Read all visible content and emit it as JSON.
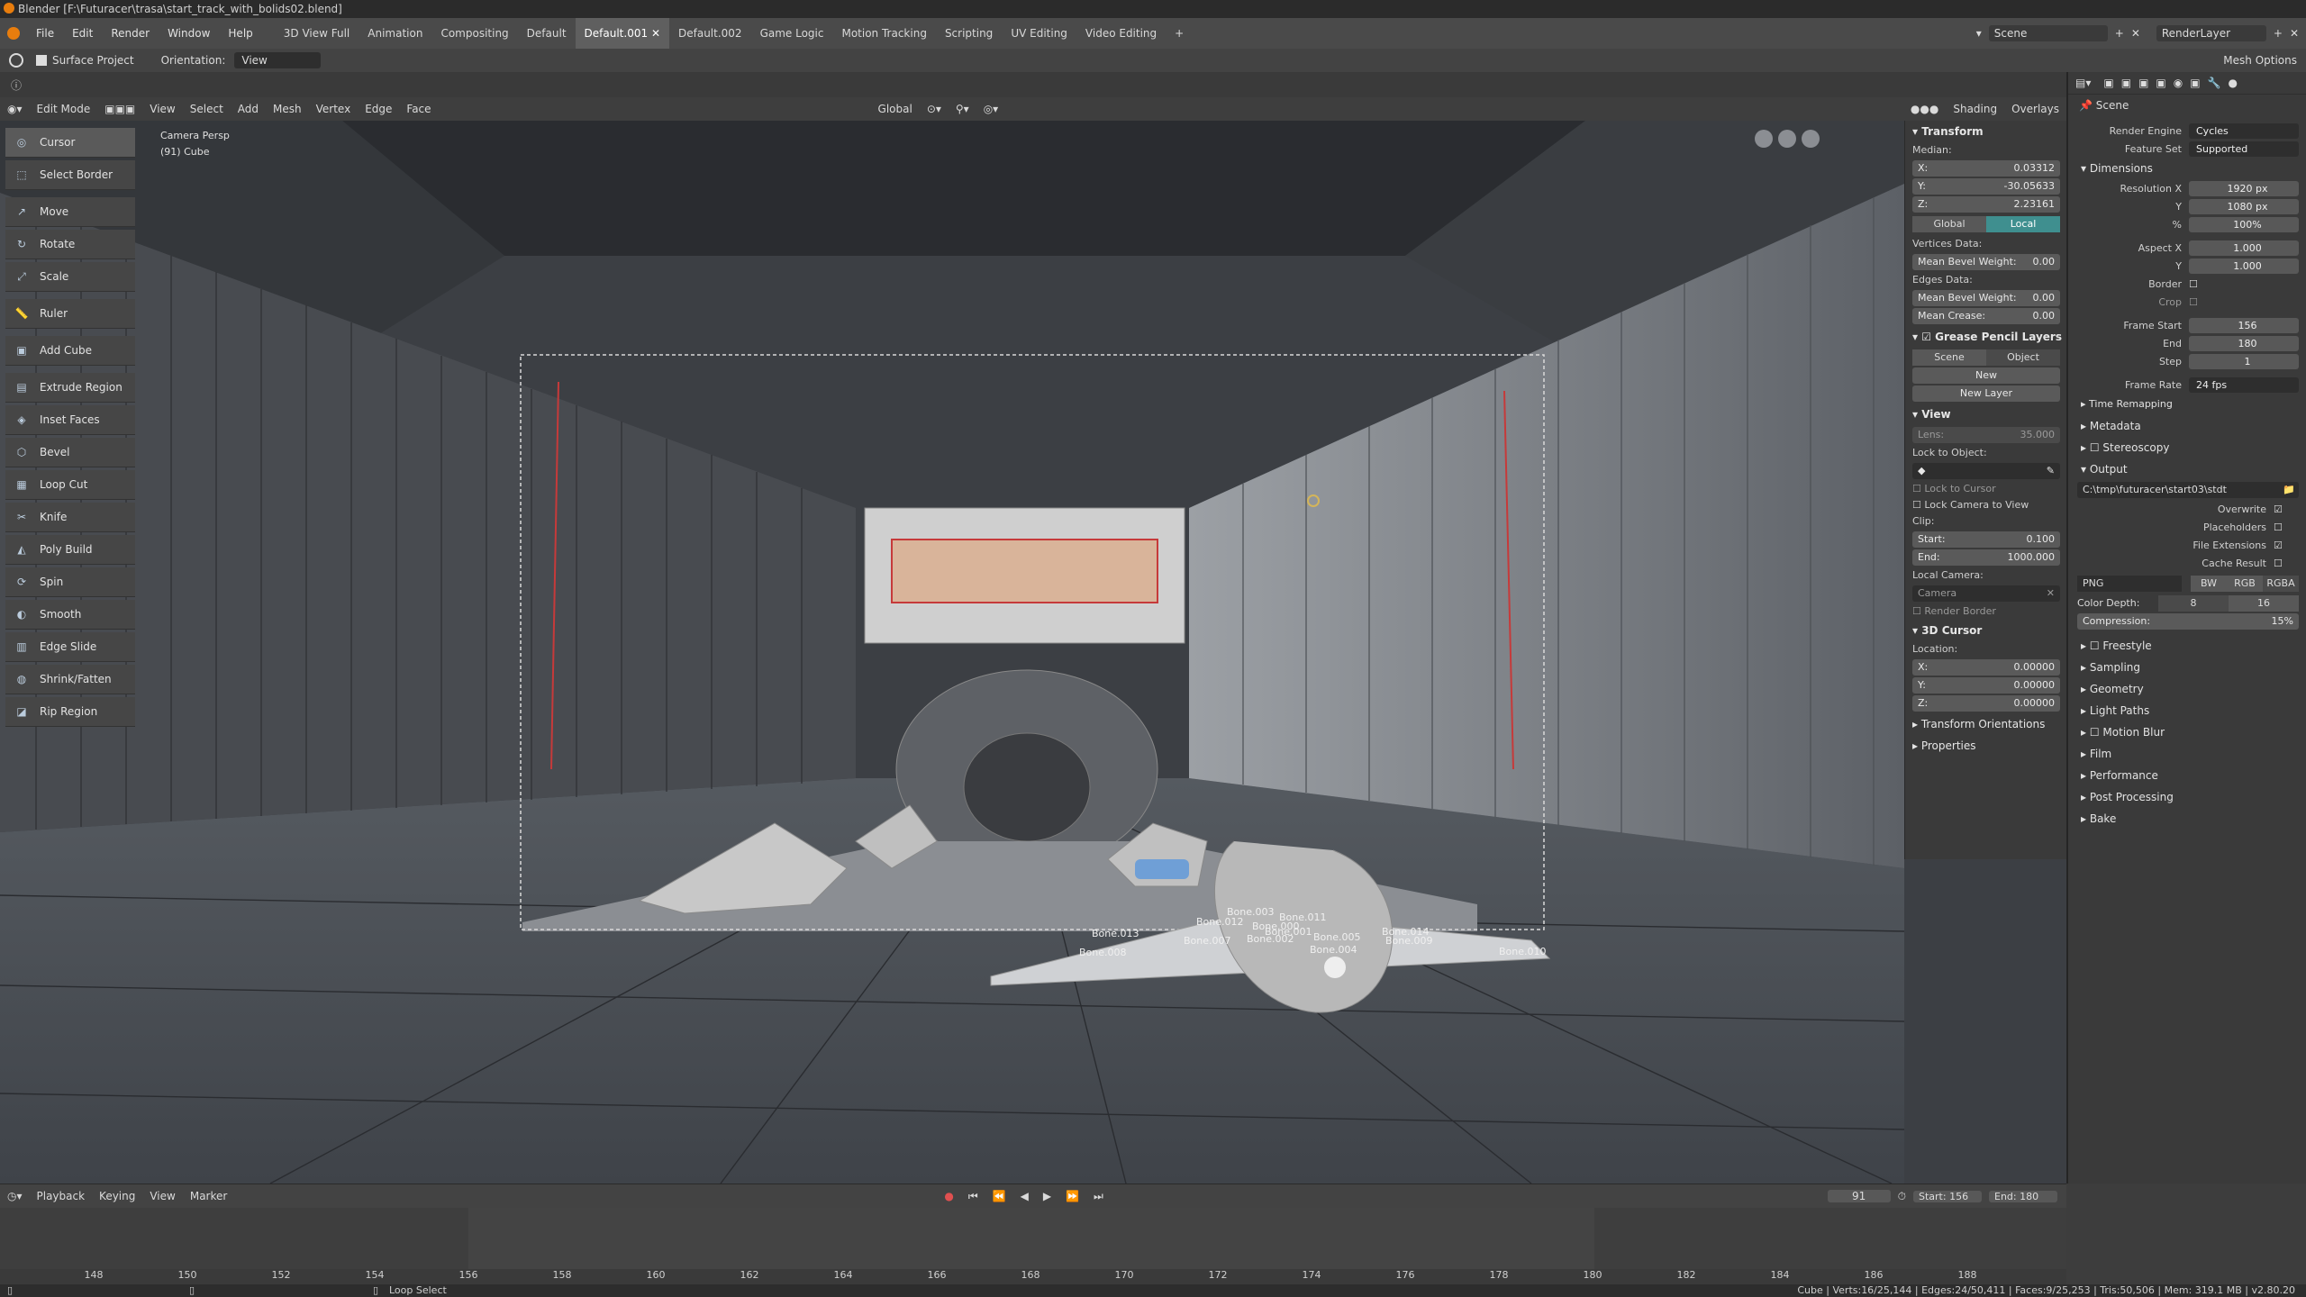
{
  "window_title": "Blender [F:\\Futuracer\\trasa\\start_track_with_bolids02.blend]",
  "menus": [
    "File",
    "Edit",
    "Render",
    "Window",
    "Help"
  ],
  "workspaces": [
    "3D View Full",
    "Animation",
    "Compositing",
    "Default",
    "Default.001",
    "Default.002",
    "Game Logic",
    "Motion Tracking",
    "Scripting",
    "UV Editing",
    "Video Editing"
  ],
  "active_workspace": "Default.001",
  "scene_name": "Scene",
  "render_layer": "RenderLayer",
  "tool_options": {
    "surface_project": "Surface Project",
    "orientation_label": "Orientation:",
    "orientation_value": "View",
    "mesh_options": "Mesh Options"
  },
  "viewport_header": {
    "mode": "Edit Mode",
    "menus": [
      "View",
      "Select",
      "Add",
      "Mesh",
      "Vertex",
      "Edge",
      "Face"
    ],
    "transform": "Global",
    "shading": "Shading",
    "overlays": "Overlays"
  },
  "viewport_info": {
    "view": "Camera Persp",
    "object": "(91) Cube"
  },
  "tools": [
    "Cursor",
    "Select Border",
    "Move",
    "Rotate",
    "Scale",
    "Ruler",
    "Add Cube",
    "Extrude Region",
    "Inset Faces",
    "Bevel",
    "Loop Cut",
    "Knife",
    "Poly Build",
    "Spin",
    "Smooth",
    "Edge Slide",
    "Shrink/Fatten",
    "Rip Region"
  ],
  "bones": [
    "Bone.013",
    "Bone.008",
    "Bone.007",
    "Bone.012",
    "Bone.003",
    "Bone.000",
    "Bone.001",
    "Bone.011",
    "Bone.002",
    "Bone.005",
    "Bone.004",
    "Bone.014",
    "Bone.009",
    "Bone.010"
  ],
  "npanel": {
    "transform": "Transform",
    "median": "Median:",
    "x": "0.03312",
    "y": "-30.05633",
    "z": "2.23161",
    "global": "Global",
    "local": "Local",
    "vertices_data": "Vertices Data:",
    "mean_bevel_weight": "Mean Bevel Weight:",
    "mbw_v": "0.00",
    "edges_data": "Edges Data:",
    "mbw_e": "0.00",
    "mean_crease": "Mean Crease:",
    "mc_v": "0.00",
    "gp_layers": "Grease Pencil Layers",
    "gp_scene": "Scene",
    "gp_object": "Object",
    "gp_new": "New",
    "gp_new_layer": "New Layer",
    "view": "View",
    "lens": "Lens:",
    "lens_v": "35.000",
    "lock_to_object": "Lock to Object:",
    "lock_to_cursor": "Lock to Cursor",
    "lock_camera": "Lock Camera to View",
    "clip": "Clip:",
    "clip_start": "Start:",
    "clip_start_v": "0.100",
    "clip_end": "End:",
    "clip_end_v": "1000.000",
    "local_camera": "Local Camera:",
    "camera": "Camera",
    "render_border": "Render Border",
    "cursor3d": "3D Cursor",
    "location": "Location:",
    "cx": "0.00000",
    "cy": "0.00000",
    "cz": "0.00000",
    "transform_orientations": "Transform Orientations",
    "properties": "Properties"
  },
  "props": {
    "scene": "Scene",
    "render_engine_l": "Render Engine",
    "render_engine": "Cycles",
    "feature_set_l": "Feature Set",
    "feature_set": "Supported",
    "dimensions": "Dimensions",
    "res_x_l": "Resolution X",
    "res_x": "1920 px",
    "res_y_l": "Y",
    "res_y": "1080 px",
    "res_pct_l": "%",
    "res_pct": "100%",
    "aspect_x_l": "Aspect X",
    "aspect_x": "1.000",
    "aspect_y_l": "Y",
    "aspect_y": "1.000",
    "border": "Border",
    "crop": "Crop",
    "frame_start_l": "Frame Start",
    "frame_start": "156",
    "end_l": "End",
    "end": "180",
    "step_l": "Step",
    "step": "1",
    "frame_rate_l": "Frame Rate",
    "frame_rate": "24 fps",
    "time_remapping": "Time Remapping",
    "metadata": "Metadata",
    "stereoscopy": "Stereoscopy",
    "output": "Output",
    "output_path": "C:\\tmp\\futuracer\\start03\\stdt",
    "overwrite": "Overwrite",
    "placeholders": "Placeholders",
    "file_extensions": "File Extensions",
    "cache_result": "Cache Result",
    "format": "PNG",
    "bw": "BW",
    "rgb": "RGB",
    "rgba": "RGBA",
    "color_depth_l": "Color Depth:",
    "cd8": "8",
    "cd16": "16",
    "compression": "Compression:",
    "compression_v": "15%",
    "sections": [
      "Freestyle",
      "Sampling",
      "Geometry",
      "Light Paths",
      "Motion Blur",
      "Film",
      "Performance",
      "Post Processing",
      "Bake"
    ]
  },
  "timeline": {
    "menus": [
      "Playback",
      "Keying",
      "View",
      "Marker"
    ],
    "current_frame": "91",
    "start_l": "Start:",
    "start": "156",
    "end_l": "End:",
    "end": "180",
    "ticks": [
      "148",
      "150",
      "152",
      "154",
      "156",
      "158",
      "160",
      "162",
      "164",
      "166",
      "168",
      "170",
      "172",
      "174",
      "176",
      "178",
      "180",
      "182",
      "184",
      "186",
      "188"
    ]
  },
  "status": {
    "left": "Loop Select",
    "right": "Cube | Verts:16/25,144 | Edges:24/50,411 | Faces:9/25,253 | Tris:50,506 | Mem: 319.1 MB | v2.80.20"
  },
  "colors": {
    "accent": "#4a90b8",
    "local_active": "#3f8f8f",
    "red_edge": "#c63a3a"
  }
}
